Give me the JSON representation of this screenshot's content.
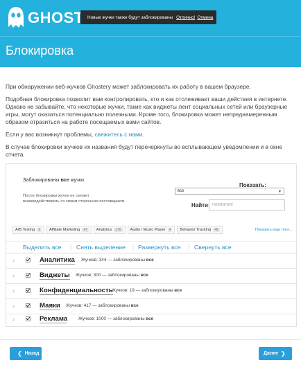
{
  "header": {
    "logo_text": "GHOSTERY",
    "notification": {
      "text": "Новые жучки также будут заблокированы",
      "ok_link": "Отлично!",
      "cancel_link": "Отмена"
    }
  },
  "page_title": "Блокировка",
  "intro": {
    "p1": "При обнаружении веб-жучков Ghostery может заблокировать их работу в вашем браузере.",
    "p2": "Подобная блокировка позволит вам контролировать, кто и как отслеживает ваши действия в интернете. Однако не забывайте, что некоторые жучки, такие как виджеты лент социальных сетей или браузерные игры, могут оказаться потенциально полезными. Кроме того, блокировка может непреднамеренным образом отразиться на работе посещаемых вами сайтов.",
    "p3_prefix": "Если у вас возникнут проблемы,",
    "p3_link": "свяжитесь с нами.",
    "p4": "В случае блокировки жучков их названия будут перечеркнуты во всплывающем уведомлении и в окне отчета."
  },
  "panel": {
    "status_prefix": "Заблокированы",
    "status_bold": "все",
    "status_suffix": "жучки.",
    "note": "После блокировки жучок не сможет взаимодействовать со своим сторонним поставщиком.",
    "show_label": "Показать:",
    "show_value": "все",
    "find_label": "Найти:",
    "find_placeholder": "название",
    "categories": [
      {
        "label": "A/B Testing",
        "count": "9"
      },
      {
        "label": "Affiliate Marketing",
        "count": "47"
      },
      {
        "label": "Analytics",
        "count": "176"
      },
      {
        "label": "Audio / Music Player",
        "count": "4"
      },
      {
        "label": "Behavior Tracking",
        "count": "48"
      }
    ],
    "more_tags": "Показать еще теги...",
    "actions": {
      "select_all": "Выделить все",
      "deselect": "Снять выделение",
      "expand_all": "Развернуть все",
      "collapse_all": "Свернуть все"
    },
    "rows": [
      {
        "name": "Аналитика",
        "meta": "Жучков: 344 — заблокированы",
        "bold": "все"
      },
      {
        "name": "Виджеты",
        "meta": "Жучков: 300 — заблокированы",
        "bold": "все"
      },
      {
        "name": "Конфиденциальность",
        "meta": "Жучков: 19 — заблокированы",
        "bold": "все"
      },
      {
        "name": "Маяки",
        "meta": "Жучков: 417 — заблокированы",
        "bold": "все"
      },
      {
        "name": "Реклама",
        "meta": "Жучков: 1000 — заблокированы",
        "bold": "все"
      }
    ]
  },
  "footer": {
    "back": "Назад",
    "next": "Далее"
  },
  "colors": {
    "brand": "#24b1dd",
    "link": "#2a8fc4",
    "button": "#2a9fdc"
  }
}
